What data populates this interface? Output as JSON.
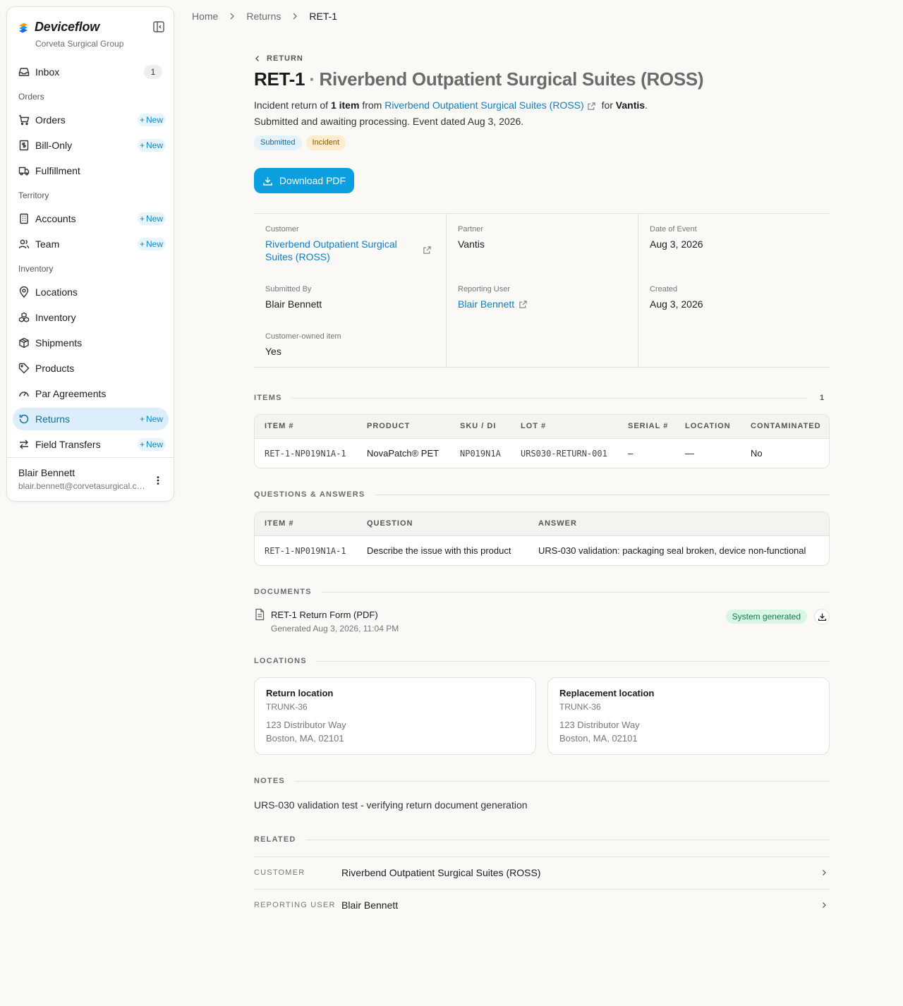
{
  "sidebar": {
    "brand": "Deviceflow",
    "org": "Corveta Surgical Group",
    "inbox": {
      "label": "Inbox",
      "count": "1"
    },
    "sections": {
      "orders": "Orders",
      "territory": "Territory",
      "inventory": "Inventory"
    },
    "items": [
      {
        "label": "Orders",
        "icon": "cart-icon",
        "new": "New"
      },
      {
        "label": "Bill-Only",
        "icon": "receipt-icon",
        "new": "New"
      },
      {
        "label": "Fulfillment",
        "icon": "truck-icon"
      },
      {
        "label": "Accounts",
        "icon": "building-icon",
        "new": "New"
      },
      {
        "label": "Team",
        "icon": "users-icon",
        "new": "New"
      },
      {
        "label": "Locations",
        "icon": "map-pin-icon"
      },
      {
        "label": "Inventory",
        "icon": "boxes-icon"
      },
      {
        "label": "Shipments",
        "icon": "package-icon"
      },
      {
        "label": "Products",
        "icon": "tag-icon"
      },
      {
        "label": "Par Agreements",
        "icon": "gauge-icon"
      },
      {
        "label": "Returns",
        "icon": "rotate-icon",
        "new": "New",
        "active": true
      },
      {
        "label": "Field Transfers",
        "icon": "transfer-icon",
        "new": "New"
      }
    ],
    "user": {
      "name": "Blair Bennett",
      "email": "blair.bennett@corvetasurgical.com"
    }
  },
  "breadcrumb": [
    "Home",
    "Returns",
    "RET-1"
  ],
  "header": {
    "back": "RETURN",
    "id": "RET-1",
    "dot": "·",
    "location": "Riverbend Outpatient Surgical Suites (ROSS)",
    "summary": {
      "pre": "Incident return of",
      "count": "1 item",
      "from": "from",
      "customer": "Riverbend Outpatient Surgical Suites (ROSS)",
      "for": "for",
      "partner": "Vantis",
      "period": ".",
      "line2": "Submitted and awaiting processing. Event dated Aug 3, 2026."
    },
    "badges": [
      "Submitted",
      "Incident"
    ],
    "download": "Download PDF"
  },
  "details": {
    "customer_label": "Customer",
    "customer": "Riverbend Outpatient Surgical Suites (ROSS)",
    "submitted_by_label": "Submitted By",
    "submitted_by": "Blair Bennett",
    "customer_owned_label": "Customer-owned item",
    "customer_owned": "Yes",
    "partner_label": "Partner",
    "partner": "Vantis",
    "reporting_user_label": "Reporting User",
    "reporting_user": "Blair Bennett",
    "date_label": "Date of Event",
    "date": "Aug 3, 2026",
    "created_label": "Created",
    "created": "Aug 3, 2026"
  },
  "items": {
    "heading": "ITEMS",
    "count": "1",
    "columns": [
      "ITEM #",
      "PRODUCT",
      "SKU / DI",
      "LOT #",
      "SERIAL #",
      "LOCATION",
      "CONTAMINATED"
    ],
    "rows": [
      [
        "RET-1-NP019N1A-1",
        "NovaPatch® PET",
        "NP019N1A",
        "URS030-RETURN-001",
        "–",
        "—",
        "No"
      ]
    ]
  },
  "qa": {
    "heading": "QUESTIONS & ANSWERS",
    "columns": [
      "ITEM #",
      "QUESTION",
      "ANSWER"
    ],
    "rows": [
      [
        "RET-1-NP019N1A-1",
        "Describe the issue with this product",
        "URS-030 validation: packaging seal broken, device non-functional"
      ]
    ]
  },
  "documents": {
    "heading": "DOCUMENTS",
    "title": "RET-1 Return Form (PDF)",
    "generated": "Generated Aug 3, 2026, 11:04 PM",
    "badge": "System generated"
  },
  "locations": {
    "heading": "LOCATIONS",
    "cards": [
      {
        "title": "Return location",
        "code": "TRUNK-36",
        "line1": "123 Distributor Way",
        "line2": "Boston, MA, 02101"
      },
      {
        "title": "Replacement location",
        "code": "TRUNK-36",
        "line1": "123 Distributor Way",
        "line2": "Boston, MA, 02101"
      }
    ]
  },
  "notes": {
    "heading": "NOTES",
    "text": "URS-030 validation test - verifying return document generation"
  },
  "related": {
    "heading": "RELATED",
    "rows": [
      {
        "label": "CUSTOMER",
        "value": "Riverbend Outpatient Surgical Suites (ROSS)"
      },
      {
        "label": "REPORTING USER",
        "value": "Blair Bennett"
      }
    ]
  },
  "colors": {
    "accent": "#0b9fe0",
    "link": "#0b7fc4",
    "active_bg": "#dbeefa"
  }
}
